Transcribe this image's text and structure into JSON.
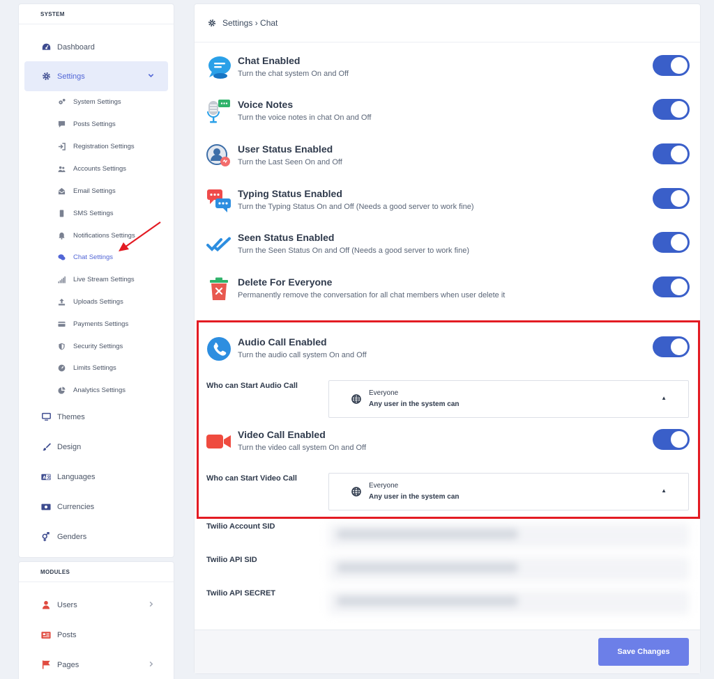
{
  "sidebar": {
    "system_heading": "SYSTEM",
    "items": [
      {
        "label": "Dashboard",
        "icon": "dashboard-icon"
      },
      {
        "label": "Settings",
        "icon": "gear-icon"
      },
      {
        "label": "Themes",
        "icon": "monitor-icon"
      },
      {
        "label": "Design",
        "icon": "brush-icon"
      },
      {
        "label": "Languages",
        "icon": "language-icon"
      },
      {
        "label": "Currencies",
        "icon": "money-icon"
      },
      {
        "label": "Genders",
        "icon": "gender-icon"
      }
    ],
    "sub_items": [
      {
        "label": "System Settings",
        "icon": "cogs-icon"
      },
      {
        "label": "Posts Settings",
        "icon": "comment-icon"
      },
      {
        "label": "Registration Settings",
        "icon": "sign-in-icon"
      },
      {
        "label": "Accounts Settings",
        "icon": "users-icon"
      },
      {
        "label": "Email Settings",
        "icon": "envelope-icon"
      },
      {
        "label": "SMS Settings",
        "icon": "mobile-icon"
      },
      {
        "label": "Notifications Settings",
        "icon": "bell-icon"
      },
      {
        "label": "Chat Settings",
        "icon": "chat-icon"
      },
      {
        "label": "Live Stream Settings",
        "icon": "signal-icon"
      },
      {
        "label": "Uploads Settings",
        "icon": "upload-icon"
      },
      {
        "label": "Payments Settings",
        "icon": "credit-card-icon"
      },
      {
        "label": "Security Settings",
        "icon": "shield-icon"
      },
      {
        "label": "Limits Settings",
        "icon": "gauge-icon"
      },
      {
        "label": "Analytics Settings",
        "icon": "pie-chart-icon"
      }
    ],
    "modules_heading": "MODULES",
    "modules": [
      {
        "label": "Users",
        "icon": "user-icon"
      },
      {
        "label": "Posts",
        "icon": "newspaper-icon"
      },
      {
        "label": "Pages",
        "icon": "flag-icon"
      }
    ]
  },
  "main": {
    "breadcrumb": "Settings › Chat",
    "settings": [
      {
        "title": "Chat Enabled",
        "desc": "Turn the chat system On and Off",
        "enabled": true
      },
      {
        "title": "Voice Notes",
        "desc": "Turn the voice notes in chat On and Off",
        "enabled": true
      },
      {
        "title": "User Status Enabled",
        "desc": "Turn the Last Seen On and Off",
        "enabled": true
      },
      {
        "title": "Typing Status Enabled",
        "desc": "Turn the Typing Status On and Off (Needs a good server to work fine)",
        "enabled": true
      },
      {
        "title": "Seen Status Enabled",
        "desc": "Turn the Seen Status On and Off (Needs a good server to work fine)",
        "enabled": true
      },
      {
        "title": "Delete For Everyone",
        "desc": "Permanently remove the conversation for all chat members when user delete it",
        "enabled": true
      },
      {
        "title": "Audio Call Enabled",
        "desc": "Turn the audio call system On and Off",
        "enabled": true
      },
      {
        "title": "Video Call Enabled",
        "desc": "Turn the video call system On and Off",
        "enabled": true
      }
    ],
    "audio_who_label": "Who can Start Audio Call",
    "video_who_label": "Who can Start Video Call",
    "audio_select": {
      "title": "Everyone",
      "sub": "Any user in the system can"
    },
    "video_select": {
      "title": "Everyone",
      "sub": "Any user in the system can"
    },
    "twilio_account_sid_label": "Twilio Account SID",
    "twilio_api_sid_label": "Twilio API SID",
    "twilio_api_secret_label": "Twilio API SECRET",
    "save_label": "Save Changes"
  },
  "colors": {
    "accent": "#3a5fc9",
    "save_button": "#6c7fe8",
    "highlight": "#e31b23",
    "annotation_arrow": "#e31b23"
  }
}
